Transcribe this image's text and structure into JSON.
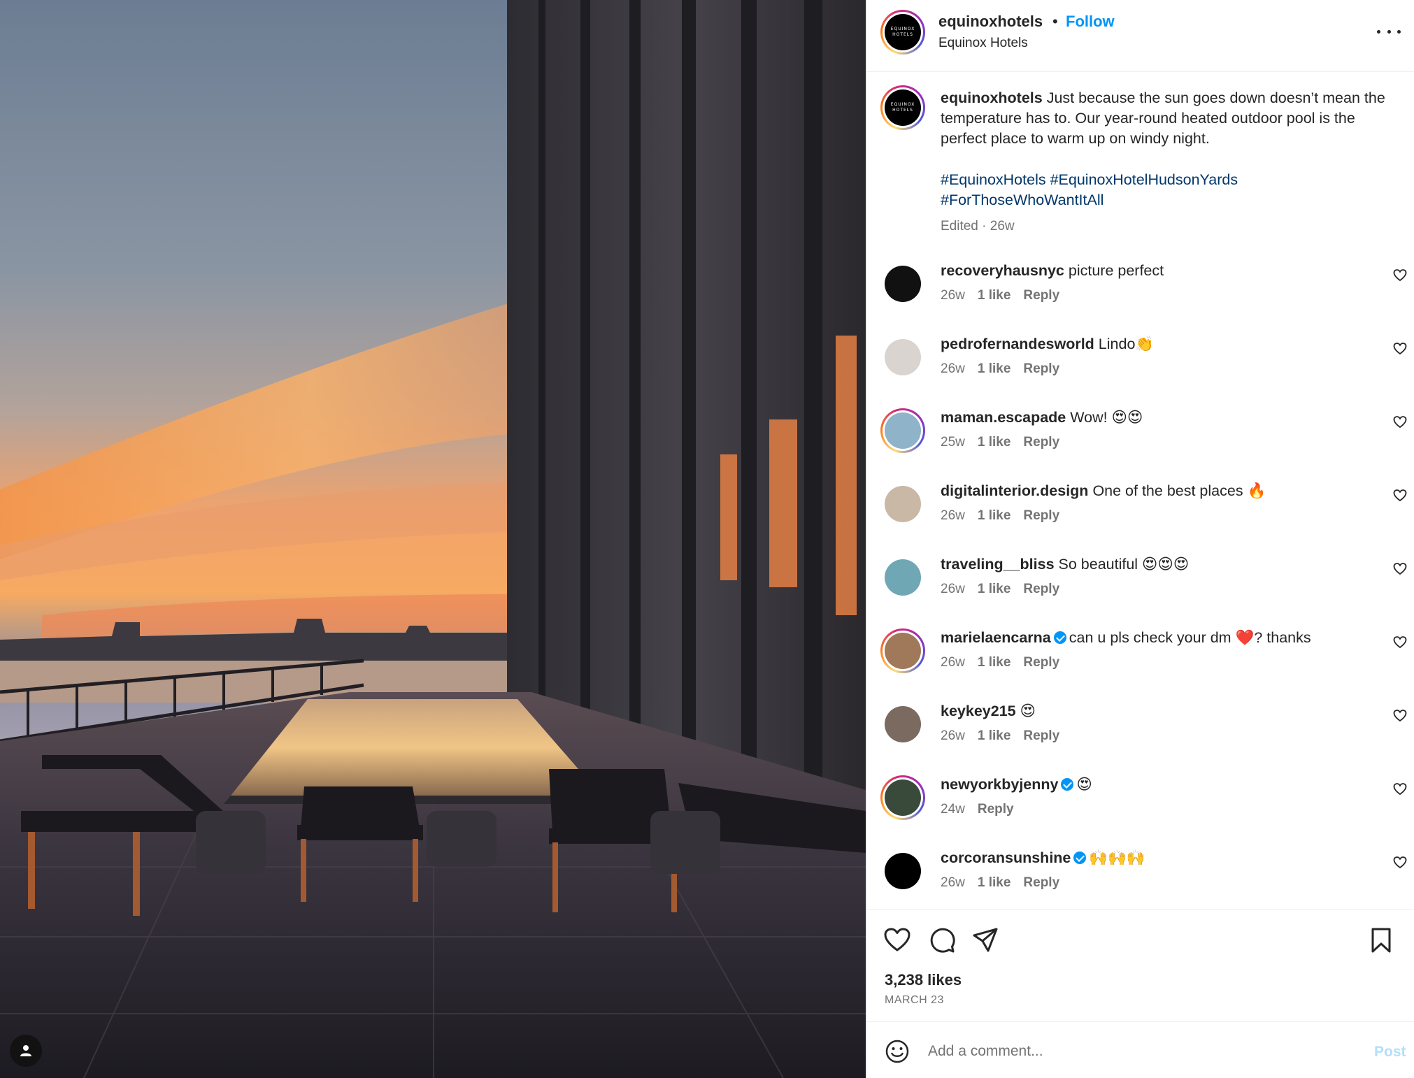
{
  "post": {
    "username": "equinoxhotels",
    "separator": "•",
    "follow_label": "Follow",
    "subtitle": "Equinox Hotels",
    "logo_text_top": "EQUINOX",
    "logo_text_bottom": "HOTELS"
  },
  "caption": {
    "username": "equinoxhotels",
    "text": "Just because the sun goes down doesn’t mean the temperature has to. Our year-round heated outdoor pool is the perfect place to warm up on windy night.",
    "hashtags": [
      "#EquinoxHotels",
      "#EquinoxHotelHudsonYards",
      "#ForThoseWhoWantItAll"
    ],
    "edited": "Edited · 26w"
  },
  "comments": [
    {
      "user": "recoveryhausnyc",
      "text": "picture perfect",
      "time": "26w",
      "likes": "1 like",
      "reply": "Reply",
      "verified": false,
      "ring": false,
      "avatar_color": "#111111"
    },
    {
      "user": "pedrofernandesworld",
      "text": "Lindo👏",
      "time": "26w",
      "likes": "1 like",
      "reply": "Reply",
      "verified": false,
      "ring": false,
      "avatar_color": "#d9d4cf"
    },
    {
      "user": "maman.escapade",
      "text": "Wow! 😍😍",
      "time": "25w",
      "likes": "1 like",
      "reply": "Reply",
      "verified": false,
      "ring": true,
      "avatar_color": "#8fb3c9"
    },
    {
      "user": "digitalinterior.design",
      "text": "One of the best places 🔥",
      "time": "26w",
      "likes": "1 like",
      "reply": "Reply",
      "verified": false,
      "ring": false,
      "avatar_color": "#c9b8a6"
    },
    {
      "user": "traveling__bliss",
      "text": "So beautiful 😍😍😍",
      "time": "26w",
      "likes": "1 like",
      "reply": "Reply",
      "verified": false,
      "ring": false,
      "avatar_color": "#6fa7b5"
    },
    {
      "user": "marielaencarna",
      "text": "can u pls check your dm ❤️? thanks",
      "time": "26w",
      "likes": "1 like",
      "reply": "Reply",
      "verified": true,
      "ring": true,
      "avatar_color": "#a0785a"
    },
    {
      "user": "keykey215",
      "text": "😍",
      "time": "26w",
      "likes": "1 like",
      "reply": "Reply",
      "verified": false,
      "ring": false,
      "avatar_color": "#7a6a60"
    },
    {
      "user": "newyorkbyjenny",
      "text": "😍",
      "time": "24w",
      "likes": "",
      "reply": "Reply",
      "verified": true,
      "ring": true,
      "avatar_color": "#3a4a3a"
    },
    {
      "user": "corcoransunshine",
      "text": "🙌🙌🙌",
      "time": "26w",
      "likes": "1 like",
      "reply": "Reply",
      "verified": true,
      "ring": false,
      "avatar_color": "#000000"
    }
  ],
  "stats": {
    "likes": "3,238 likes",
    "date": "MARCH 23"
  },
  "composer": {
    "placeholder": "Add a comment...",
    "post_label": "Post"
  },
  "colors": {
    "accent": "#0095f6",
    "hashtag": "#00376b",
    "muted": "#737373",
    "post_disabled": "#b2dffc"
  },
  "icons": [
    "user-tag-icon",
    "more-options-icon",
    "heart-icon",
    "comment-icon",
    "share-icon",
    "bookmark-icon",
    "emoji-icon",
    "verified-badge-icon"
  ]
}
